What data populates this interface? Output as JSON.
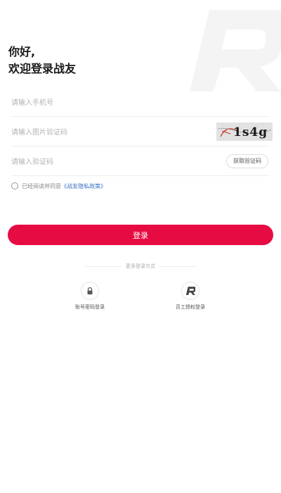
{
  "greeting": {
    "line1": "你好,",
    "line2": "欢迎登录战友"
  },
  "form": {
    "phone": {
      "placeholder": "请输入手机号",
      "value": ""
    },
    "image_code": {
      "placeholder": "请输入图片验证码",
      "value": "",
      "captcha_text": "1s4g"
    },
    "sms_code": {
      "placeholder": "请输入验证码",
      "value": "",
      "get_code_label": "获取验证码"
    }
  },
  "agreement": {
    "prefix": "已经阅读并同意",
    "policy_link": "《战友隐私政策》",
    "checked": false
  },
  "login_button": "登录",
  "more_login": {
    "title": "更多登录方式",
    "options": [
      {
        "label": "账号密码登录",
        "icon": "lock-icon"
      },
      {
        "label": "员工授权登录",
        "icon": "brand-r-icon"
      }
    ]
  },
  "colors": {
    "primary": "#e60b43",
    "link": "#3a6fc4",
    "placeholder": "#b3b3b3",
    "divider": "#eeeeee"
  }
}
